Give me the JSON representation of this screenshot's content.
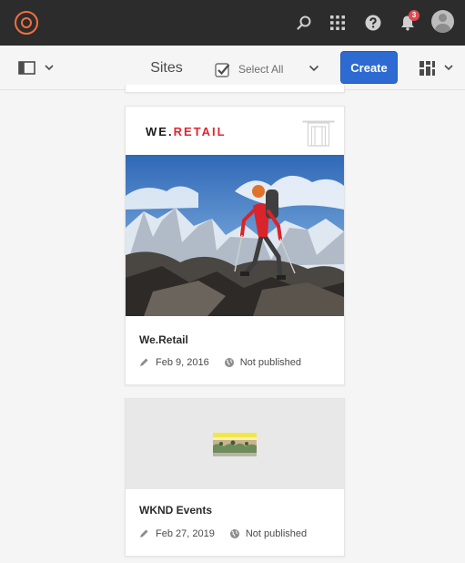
{
  "topbar": {
    "logo_icon": "adobe-experience-cloud-icon",
    "search_icon": "search-icon",
    "apps_icon": "apps-grid-icon",
    "help_icon": "help-icon",
    "notifications_icon": "bell-icon",
    "notifications_count": "3",
    "avatar_icon": "user-avatar-icon"
  },
  "actionbar": {
    "rail_toggle_icon": "panel-toggle-icon",
    "title": "Sites",
    "select_all_label": "Select All",
    "create_label": "Create",
    "view_switcher_icon": "card-view-icon"
  },
  "colors": {
    "topbar_bg": "#2c2c2c",
    "logo_accent": "#f2703d",
    "primary_button": "#2d6bd3",
    "brand_red": "#e3262e",
    "badge_red": "#e34850"
  },
  "cards": [
    {
      "title": "We.Retail",
      "brand_text": "WE.",
      "brand_accent_text": "RETAIL",
      "edited_date": "Feb 9, 2016",
      "publish_status": "Not published"
    },
    {
      "title": "WKND Events",
      "edited_date": "Feb 27, 2019",
      "publish_status": "Not published"
    }
  ]
}
